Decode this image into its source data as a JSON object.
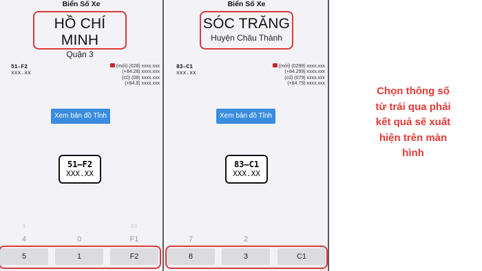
{
  "panels": [
    {
      "app_title": "Biển Số Xe",
      "province": "HỒ CHÍ MINH",
      "district": "Quận 3",
      "code_top": "51–F2",
      "code_bottom": "xxx.xx",
      "phones": [
        "(mới) (028) xxxx.xxx",
        "(+84.28) xxxx.xxx",
        "(cũ) (08) xxxx.xxx",
        "(+84.8) xxxx.xxx"
      ],
      "map_button": "Xem bản đồ Tỉnh",
      "plate_top": "51–F2",
      "plate_bottom": "XXX.XX",
      "picker": {
        "faint": [
          "3",
          "",
          "E1"
        ],
        "mid": [
          "4",
          "0",
          "F1"
        ],
        "selected": [
          "5",
          "1",
          "F2"
        ]
      }
    },
    {
      "app_title": "Biển Số Xe",
      "province": "SÓC TRĂNG",
      "district": "Huyện Châu Thành",
      "code_top": "83–C1",
      "code_bottom": "xxx.xx",
      "phones": [
        "(mới) (0299) xxxx.xxx",
        "(+84.299) xxxx.xxx",
        "(cũ) (079) xxxx.xxx",
        "(+84.79) xxxx.xxx"
      ],
      "map_button": "Xem bản đồ Tỉnh",
      "plate_top": "83–C1",
      "plate_bottom": "XXX.XX",
      "picker": {
        "faint": [
          "",
          "",
          ""
        ],
        "mid": [
          "7",
          "2",
          ""
        ],
        "selected": [
          "8",
          "3",
          "C1"
        ]
      }
    }
  ],
  "caption": [
    "Chọn thông  số",
    "từ trái qua phải",
    "kết quả sẽ xuất",
    "hiện trên màn",
    "hình"
  ],
  "colors": {
    "highlight": "#d93a3a",
    "button": "#3a8dde",
    "caption": "#e53935"
  }
}
